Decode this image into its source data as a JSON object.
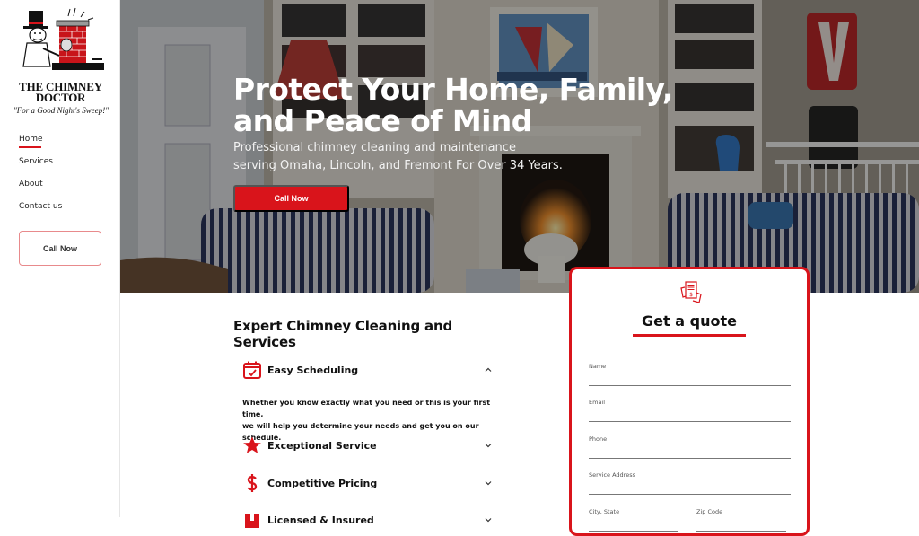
{
  "brand": {
    "name_line1": "THE CHIMNEY",
    "name_line2": "DOCTOR",
    "tagline": "\"For a Good Night's Sweep!\"",
    "accent": "#d9141b"
  },
  "sidebar": {
    "nav": [
      {
        "label": "Home",
        "active": true
      },
      {
        "label": "Services",
        "active": false
      },
      {
        "label": "About",
        "active": false
      },
      {
        "label": "Contact us",
        "active": false
      }
    ],
    "call_button": "Call Now"
  },
  "hero": {
    "title": "Protect Your Home, Family, and Peace of Mind",
    "subtitle_line1": "Professional chimney cleaning and maintenance",
    "subtitle_line2": "serving Omaha, Lincoln, and Fremont For Over 34 Years.",
    "call_button": "Call Now"
  },
  "services": {
    "title": "Expert Chimney Cleaning and Services",
    "items": [
      {
        "label": "Easy Scheduling",
        "icon": "calendar-check-icon",
        "expanded": true,
        "body_line1": "Whether you know exactly what you need or this is your first time,",
        "body_line2": "we  will help you determine your needs and get you on our schedule."
      },
      {
        "label": "Exceptional Service",
        "icon": "star-icon",
        "expanded": false
      },
      {
        "label": "Competitive Pricing",
        "icon": "dollar-icon",
        "expanded": false
      },
      {
        "label": "Licensed & Insured",
        "icon": "license-icon",
        "expanded": false
      }
    ]
  },
  "quote": {
    "title": "Get a quote",
    "fields": {
      "name": {
        "label": "Name",
        "value": ""
      },
      "email": {
        "label": "Email",
        "value": ""
      },
      "phone": {
        "label": "Phone",
        "value": ""
      },
      "address": {
        "label": "Service Address",
        "value": ""
      },
      "city_state": {
        "label": "City, State",
        "value": ""
      },
      "zip": {
        "label": "Zip Code",
        "value": ""
      }
    }
  }
}
